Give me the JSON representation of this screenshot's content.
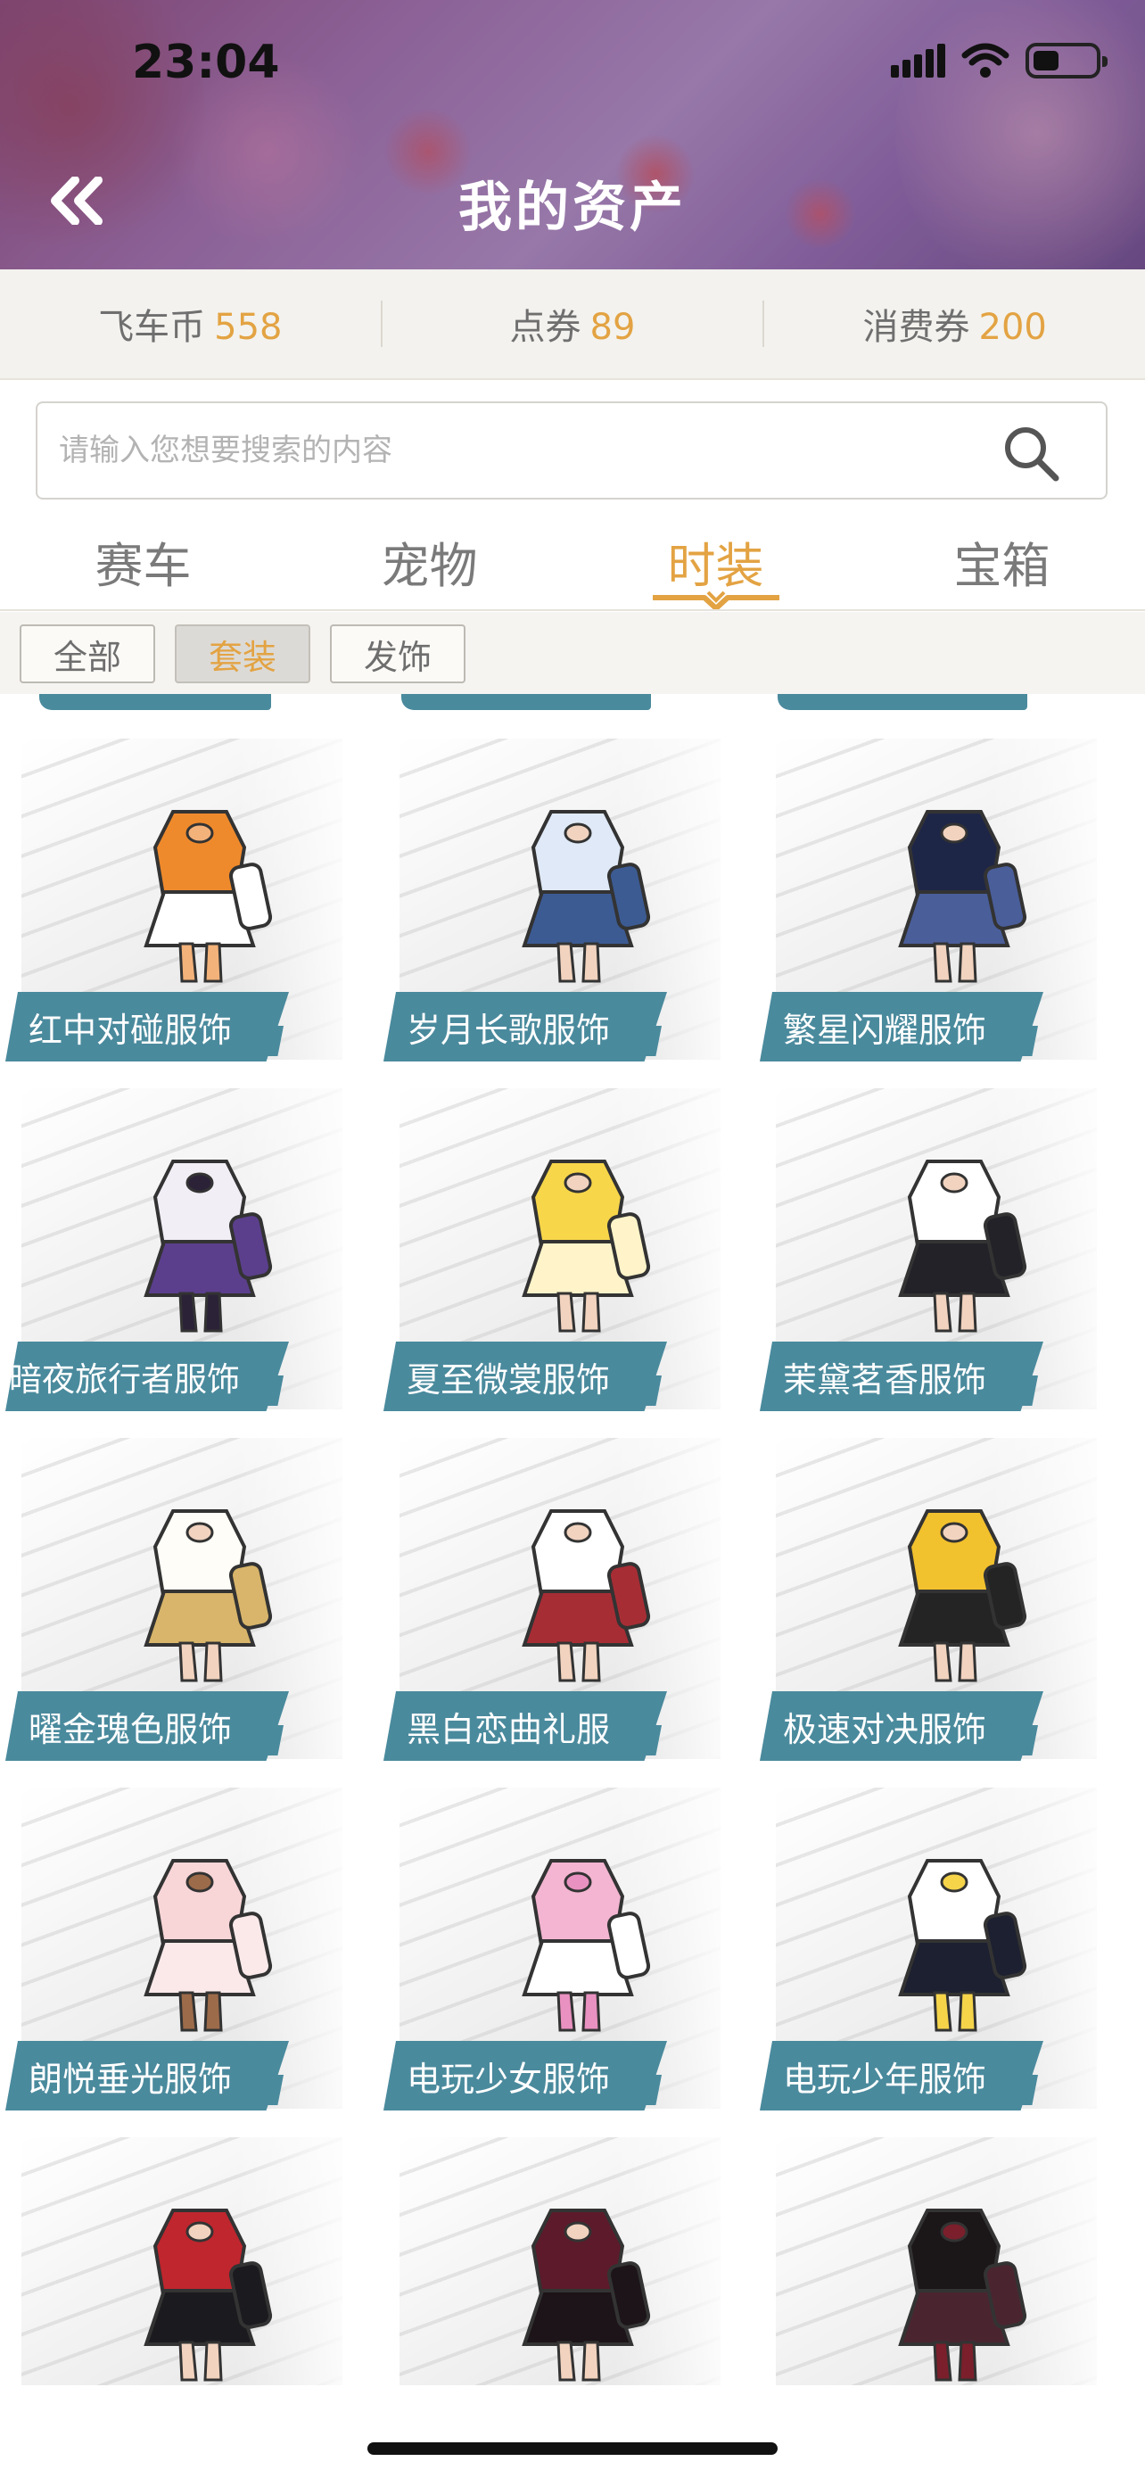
{
  "status_bar": {
    "time": "23:04"
  },
  "header": {
    "title": "我的资产"
  },
  "currencies": [
    {
      "label": "飞车币",
      "value": "558"
    },
    {
      "label": "点券",
      "value": "89"
    },
    {
      "label": "消费券",
      "value": "200"
    }
  ],
  "search": {
    "placeholder": "请输入您想要搜索的内容",
    "value": ""
  },
  "tabs": [
    {
      "label": "赛车",
      "active": false
    },
    {
      "label": "宠物",
      "active": false
    },
    {
      "label": "时装",
      "active": true
    },
    {
      "label": "宝箱",
      "active": false
    }
  ],
  "filters": [
    {
      "label": "全部",
      "active": false
    },
    {
      "label": "套装",
      "active": true
    },
    {
      "label": "发饰",
      "active": false
    }
  ],
  "items": [
    {
      "name": "红中对碰服饰",
      "icon": "outfit-orange-white-icon"
    },
    {
      "name": "岁月长歌服饰",
      "icon": "outfit-blue-dress-icon"
    },
    {
      "name": "繁星闪耀服饰",
      "icon": "outfit-navy-star-dress-icon"
    },
    {
      "name": "暗夜旅行者服饰",
      "icon": "outfit-purple-icon"
    },
    {
      "name": "夏至微裳服饰",
      "icon": "outfit-yellow-dress-icon"
    },
    {
      "name": "茉黛茗香服饰",
      "icon": "outfit-black-white-dress-icon"
    },
    {
      "name": "曜金瑰色服饰",
      "icon": "outfit-white-gold-dress-icon"
    },
    {
      "name": "黑白恋曲礼服",
      "icon": "outfit-white-red-dress-icon"
    },
    {
      "name": "极速对决服饰",
      "icon": "outfit-yellow-black-icon"
    },
    {
      "name": "朗悦垂光服饰",
      "icon": "outfit-pink-dress-icon"
    },
    {
      "name": "电玩少女服饰",
      "icon": "outfit-pink-gamer-icon"
    },
    {
      "name": "电玩少年服饰",
      "icon": "outfit-white-black-gamer-icon"
    },
    {
      "name": "",
      "icon": "outfit-red-black-icon"
    },
    {
      "name": "",
      "icon": "outfit-dark-red-dress-icon"
    },
    {
      "name": "",
      "icon": "outfit-black-suit-icon"
    }
  ],
  "colors": {
    "accent": "#e3a343",
    "label_bg": "#4a8a9d",
    "text_gray": "#7a7a7a"
  }
}
